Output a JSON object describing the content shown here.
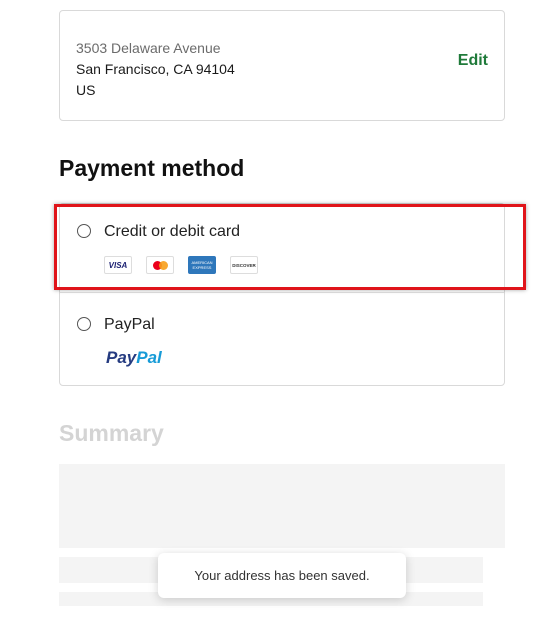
{
  "address": {
    "line1": "3503 Delaware Avenue",
    "line2": "San Francisco, CA 94104",
    "line3": "US",
    "edit_label": "Edit"
  },
  "payment": {
    "title": "Payment method",
    "options": [
      {
        "label": "Credit or debit card",
        "selected": false,
        "logos": [
          "visa-icon",
          "mastercard-icon",
          "amex-icon",
          "discover-icon"
        ]
      },
      {
        "label": "PayPal",
        "selected": false
      }
    ],
    "visa_text": "VISA",
    "amex_text": "AMERICAN EXPRESS",
    "discover_text": "DISCOVER",
    "paypal_logo": {
      "pay": "Pay",
      "pal": "Pal"
    }
  },
  "summary": {
    "title": "Summary"
  },
  "toast": {
    "message": "Your address has been saved."
  },
  "colors": {
    "accent_green": "#1f7a3a",
    "highlight_red": "#e0141a",
    "paypal_dark": "#253b80",
    "paypal_light": "#179bd7"
  }
}
